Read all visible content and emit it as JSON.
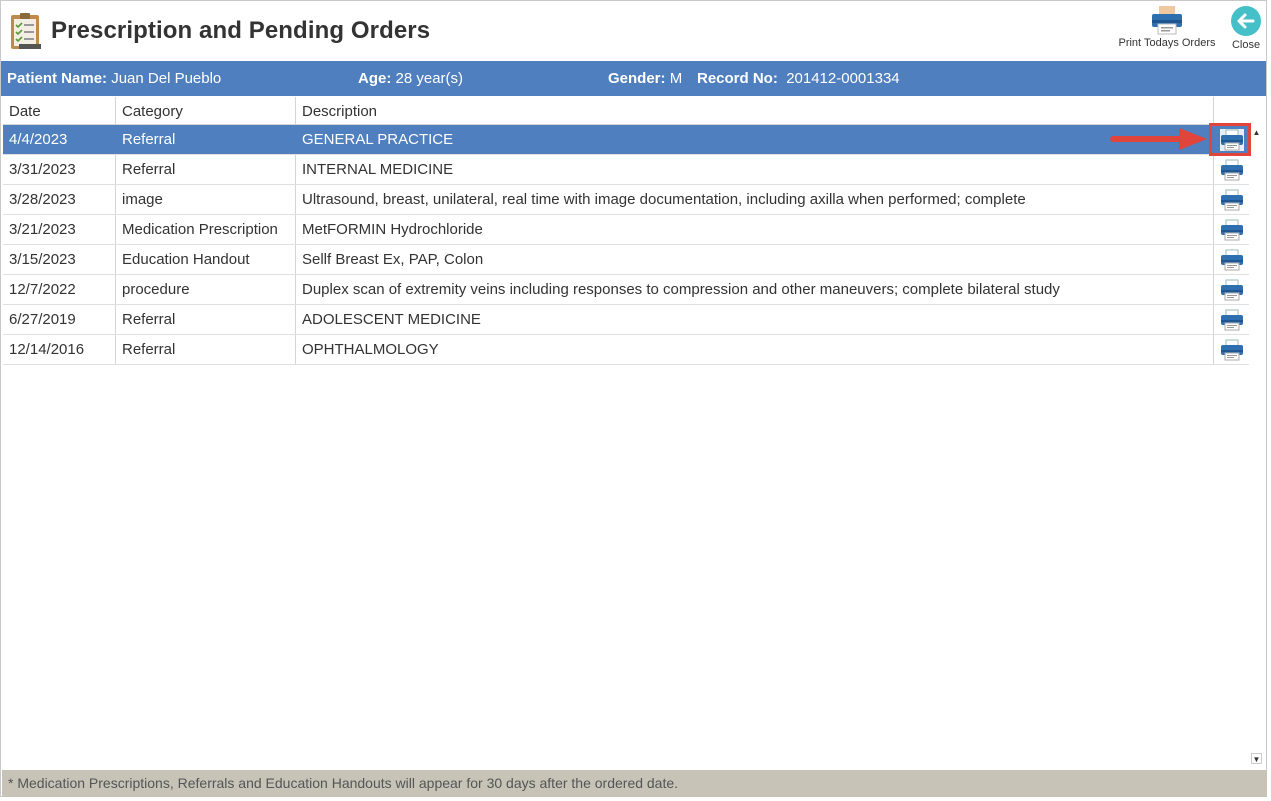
{
  "header": {
    "title": "Prescription and Pending Orders",
    "print_today_label": "Print Todays Orders",
    "close_label": "Close"
  },
  "patient": {
    "name_label": "Patient Name:",
    "name_value": "Juan Del Pueblo",
    "age_label": "Age:",
    "age_value": "28 year(s)",
    "gender_label": "Gender:",
    "gender_value": "M",
    "record_label": "Record No:",
    "record_value": "201412-0001334"
  },
  "grid": {
    "columns": [
      "Date",
      "Category",
      "Description"
    ],
    "rows": [
      {
        "date": "4/4/2023",
        "category": "Referral",
        "description": "GENERAL PRACTICE",
        "selected": true
      },
      {
        "date": "3/31/2023",
        "category": "Referral",
        "description": "INTERNAL MEDICINE"
      },
      {
        "date": "3/28/2023",
        "category": "image",
        "description": "Ultrasound, breast, unilateral, real time with image documentation, including axilla when performed; complete"
      },
      {
        "date": "3/21/2023",
        "category": "Medication Prescription",
        "description": "MetFORMIN Hydrochloride"
      },
      {
        "date": "3/15/2023",
        "category": "Education Handout",
        "description": "Sellf Breast Ex, PAP, Colon"
      },
      {
        "date": "12/7/2022",
        "category": "procedure",
        "description": "Duplex scan of extremity veins including responses to compression and other maneuvers; complete bilateral study"
      },
      {
        "date": "6/27/2019",
        "category": "Referral",
        "description": "ADOLESCENT MEDICINE"
      },
      {
        "date": "12/14/2016",
        "category": "Referral",
        "description": "OPHTHALMOLOGY"
      }
    ]
  },
  "footer": {
    "note": "* Medication Prescriptions, Referrals and Education Handouts will appear for 30 days after the ordered date."
  },
  "colors": {
    "accent": "#4f7fbe",
    "annotation": "#e0443a",
    "footer_bg": "#c7c3b7"
  },
  "icons": {
    "app": "clipboard-checklist-icon",
    "print": "printer-icon",
    "close": "back-arrow-circle-icon"
  }
}
